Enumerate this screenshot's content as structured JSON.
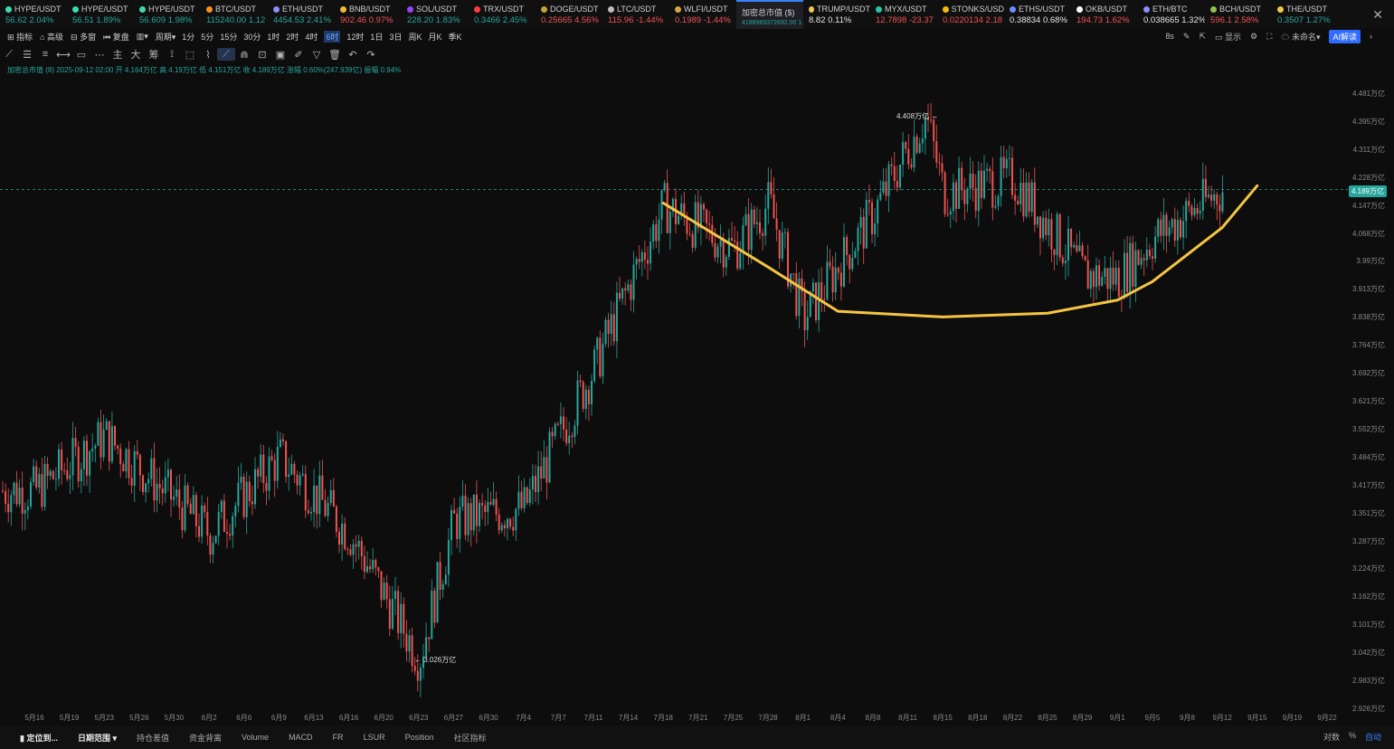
{
  "tickers": [
    {
      "name": "HYPE/USDT",
      "value": "56.62",
      "change": "2.04%",
      "dir": "up",
      "dot": "#3ddbb0"
    },
    {
      "name": "HYPE/USDT",
      "value": "56.51",
      "change": "1.89%",
      "dir": "up",
      "dot": "#3ddbb0"
    },
    {
      "name": "HYPE/USDT",
      "value": "56.609",
      "change": "1.98%",
      "dir": "up",
      "dot": "#3ddbb0"
    },
    {
      "name": "BTC/USDT",
      "value": "115240.00",
      "change": "1.12",
      "dir": "up",
      "dot": "#f7931a"
    },
    {
      "name": "ETH/USDT",
      "value": "4454.53",
      "change": "2.41%",
      "dir": "up",
      "dot": "#8c8cff"
    },
    {
      "name": "BNB/USDT",
      "value": "902.46",
      "change": "0.97%",
      "dir": "dn",
      "dot": "#f3ba2f"
    },
    {
      "name": "SOL/USDT",
      "value": "228.20",
      "change": "1.83%",
      "dir": "up",
      "dot": "#9945ff"
    },
    {
      "name": "TRX/USDT",
      "value": "0.3466",
      "change": "2.45%",
      "dir": "up",
      "dot": "#ff3b3b"
    },
    {
      "name": "DOGE/USDT",
      "value": "0.25665",
      "change": "4.56%",
      "dir": "dn",
      "dot": "#c2a633"
    },
    {
      "name": "LTC/USDT",
      "value": "115.96",
      "change": "-1.44%",
      "dir": "dn",
      "dot": "#bfbbbb"
    },
    {
      "name": "WLFI/USDT",
      "value": "0.1989",
      "change": "-1.44%",
      "dir": "dn",
      "dot": "#d9a441"
    },
    {
      "name": "加密总市值 ($)",
      "value": "4188969372692.00",
      "change": "1.33%",
      "dir": "up",
      "dot": "",
      "active": true
    },
    {
      "name": "TRUMP/USDT",
      "value": "8.82",
      "change": "0.11%",
      "dir": "wh",
      "dot": "#f2c94c"
    },
    {
      "name": "MYX/USDT",
      "value": "12.7898",
      "change": "-23.37",
      "dir": "dn",
      "dot": "#29c4a9"
    },
    {
      "name": "STONKS/USD",
      "value": "0.0220134",
      "change": "2.18",
      "dir": "dn",
      "dot": "#f0b90b"
    },
    {
      "name": "ETHS/USDT",
      "value": "0.38834",
      "change": "0.68%",
      "dir": "wh",
      "dot": "#6c8cff"
    },
    {
      "name": "OKB/USDT",
      "value": "194.73",
      "change": "1.62%",
      "dir": "dn",
      "dot": "#ffffff"
    },
    {
      "name": "ETH/BTC",
      "value": "0.038665",
      "change": "1.32%",
      "dir": "wh",
      "dot": "#8c8cff"
    },
    {
      "name": "BCH/USDT",
      "value": "596.1",
      "change": "2.58%",
      "dir": "dn",
      "dot": "#8dc351"
    },
    {
      "name": "THE/USDT",
      "value": "0.3507",
      "change": "1.27%",
      "dir": "up",
      "dot": "#f2c94c"
    }
  ],
  "toolbar": {
    "indicators": "指标",
    "advanced": "高级",
    "multi": "多窗",
    "replay": "复盘",
    "period": "周期",
    "timeframes": [
      "1分",
      "5分",
      "15分",
      "30分",
      "1时",
      "2时",
      "4时",
      "6时",
      "12时",
      "1日",
      "3日",
      "周K",
      "月K",
      "季K"
    ],
    "selected_tf": "6时",
    "interval": "8s",
    "display": "显示",
    "unnamed": "未命名",
    "ai": "AI解读"
  },
  "info": {
    "text": "加密总市值 (8)  2025-09-12 02:00  开 4.164万亿  高 4.19万亿  低 4.151万亿  收 4.189万亿  涨幅 0.60%(247.939亿)  振幅 0.94%"
  },
  "price_axis": [
    "4.481万亿",
    "4.395万亿",
    "4.311万亿",
    "4.228万亿",
    "4.147万亿",
    "4.068万亿",
    "3.99万亿",
    "3.913万亿",
    "3.838万亿",
    "3.764万亿",
    "3.692万亿",
    "3.621万亿",
    "3.552万亿",
    "3.484万亿",
    "3.417万亿",
    "3.351万亿",
    "3.287万亿",
    "3.224万亿",
    "3.162万亿",
    "3.101万亿",
    "3.042万亿",
    "2.983万亿",
    "2.926万亿"
  ],
  "current_price": "4.189万亿",
  "annotations": {
    "high": "4.408万亿",
    "low": "3.026万亿"
  },
  "date_axis": [
    "5月16",
    "5月19",
    "5月23",
    "5月26",
    "5月30",
    "6月2",
    "6月6",
    "6月9",
    "6月13",
    "6月16",
    "6月20",
    "6月23",
    "6月27",
    "6月30",
    "7月4",
    "7月7",
    "7月11",
    "7月14",
    "7月18",
    "7月21",
    "7月25",
    "7月28",
    "8月1",
    "8月4",
    "8月8",
    "8月11",
    "8月15",
    "8月18",
    "8月22",
    "8月25",
    "8月29",
    "9月1",
    "9月5",
    "9月8",
    "9月12",
    "9月15",
    "9月19",
    "9月22"
  ],
  "bottom_tabs": [
    "定位到...",
    "日期范围",
    "持仓差值",
    "资金背离",
    "Volume",
    "MACD",
    "FR",
    "LSUR",
    "Position",
    "社区指标"
  ],
  "bottom_right": [
    "对数",
    "%",
    "自动"
  ],
  "chart_data": {
    "type": "candlestick",
    "x_start": "5月16",
    "x_end": "9月12",
    "ylim": [
      2.926,
      4.481
    ],
    "y_unit": "万亿",
    "key_points": [
      {
        "x": "5月16",
        "y": 3.4
      },
      {
        "x": "5月23",
        "y": 3.53
      },
      {
        "x": "6月2",
        "y": 3.3
      },
      {
        "x": "6月9",
        "y": 3.48
      },
      {
        "x": "6月16",
        "y": 3.3
      },
      {
        "x": "6月23",
        "y": 3.026
      },
      {
        "x": "6月27",
        "y": 3.33
      },
      {
        "x": "7月4",
        "y": 3.36
      },
      {
        "x": "7月11",
        "y": 3.7
      },
      {
        "x": "7月18",
        "y": 4.14
      },
      {
        "x": "7月25",
        "y": 4.02
      },
      {
        "x": "7月28",
        "y": 4.15
      },
      {
        "x": "8月1",
        "y": 3.83
      },
      {
        "x": "8月8",
        "y": 4.12
      },
      {
        "x": "8月13",
        "y": 4.408
      },
      {
        "x": "8月15",
        "y": 4.18
      },
      {
        "x": "8月22",
        "y": 4.22
      },
      {
        "x": "8月29",
        "y": 3.95
      },
      {
        "x": "9月1",
        "y": 3.94
      },
      {
        "x": "9月5",
        "y": 4.05
      },
      {
        "x": "9月12",
        "y": 4.189
      }
    ],
    "overlay": "cup-shaped curve drawn in yellow",
    "overlay_color": "#f5c542",
    "up_color": "#26a69a",
    "down_color": "#ef5350"
  }
}
